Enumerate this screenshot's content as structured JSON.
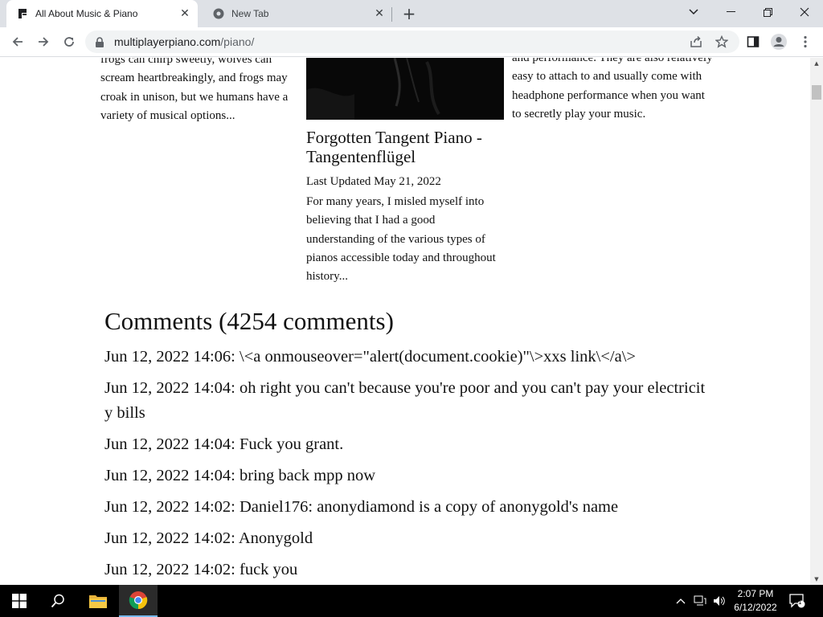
{
  "browser": {
    "tabs": [
      {
        "title": "All About Music & Piano",
        "close": "✕"
      },
      {
        "title": "New Tab",
        "close": "✕"
      }
    ],
    "new_tab": "+",
    "url_host": "multiplayerpiano.com",
    "url_path": "/piano/"
  },
  "icons": {
    "back": "back-arrow-icon",
    "forward": "forward-arrow-icon",
    "reload": "reload-icon",
    "lock": "lock-icon",
    "share": "share-icon",
    "bookmark": "star-icon",
    "sidepanel": "side-panel-icon",
    "profile": "profile-icon",
    "menu": "kebab-menu-icon"
  },
  "page": {
    "col1_text": "frogs can chirp sweetly, wolves can scream heartbreakingly, and frogs may croak in unison, but we humans have a variety of musical options...",
    "col3_text": "and performance. They are also relatively easy to attach to and usually come with headphone performance when you want to secretly play your music.",
    "post_title": "Forgotten Tangent Piano - Tangentenflügel",
    "post_date": "Last Updated May 21, 2022",
    "post_excerpt": "For many years, I misled myself into believing that I had a good understanding of the various types of pianos accessible today and throughout history...",
    "comments_heading": "Comments (4254 comments)",
    "comments": [
      "Jun 12, 2022 14:06: \\<a onmouseover=\"alert(document.cookie)\"\\>xxs link\\</a\\>",
      "Jun 12, 2022 14:04: oh right you can't because you're poor and you can't pay your electricity bills",
      "Jun 12, 2022 14:04: Fuck you grant.",
      "Jun 12, 2022 14:04: bring back mpp now",
      "Jun 12, 2022 14:02: Daniel176: anonydiamond is a copy of anonygold's name",
      "Jun 12, 2022 14:02: Anonygold",
      "Jun 12, 2022 14:02: fuck you"
    ]
  },
  "taskbar": {
    "time": "2:07 PM",
    "date": "6/12/2022",
    "notification_count": "1"
  }
}
